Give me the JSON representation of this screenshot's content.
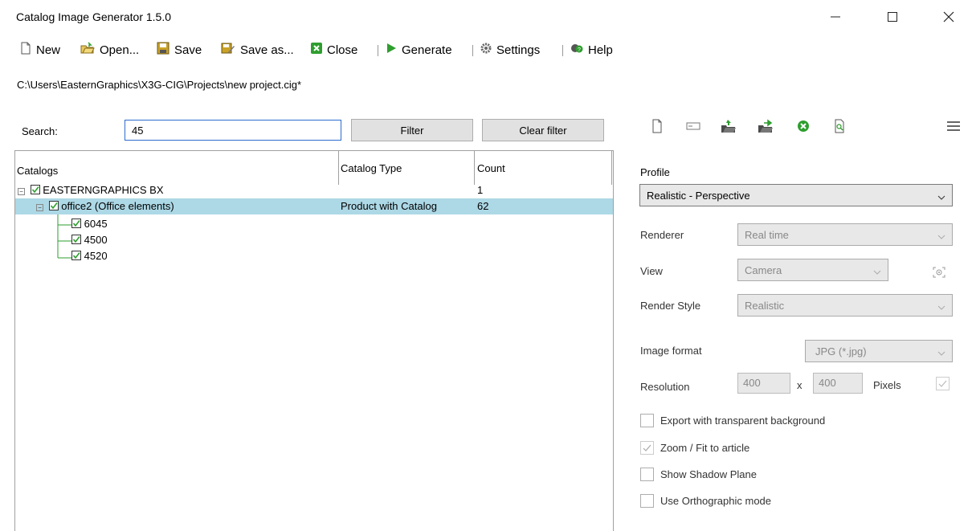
{
  "window": {
    "title": "Catalog Image Generator 1.5.0",
    "minimize_icon": "minimize-icon",
    "maximize_icon": "maximize-icon",
    "close_icon": "close-icon"
  },
  "toolbar": {
    "new_label": "New",
    "open_label": "Open...",
    "save_label": "Save",
    "saveas_label": "Save as...",
    "close_label": "Close",
    "generate_label": "Generate",
    "settings_label": "Settings",
    "help_label": "Help"
  },
  "project_path": "C:\\Users\\EasternGraphics\\X3G-CIG\\Projects\\new project.cig*",
  "search": {
    "label": "Search:",
    "value": "45",
    "filter_label": "Filter",
    "clear_filter_label": "Clear filter"
  },
  "grid": {
    "columns": [
      "Catalogs",
      "Catalog Type",
      "Count"
    ],
    "rows": [
      {
        "name": "EASTERNGRAPHICS BX",
        "type": "",
        "count": "1"
      },
      {
        "name": "office2 (Office elements)",
        "type": "Product with Catalog",
        "count": "62"
      },
      {
        "name": "6045",
        "type": "",
        "count": ""
      },
      {
        "name": "4500",
        "type": "",
        "count": ""
      },
      {
        "name": "4520",
        "type": "",
        "count": ""
      }
    ]
  },
  "profile_panel": {
    "profile_label": "Profile",
    "profile_value": "Realistic - Perspective",
    "renderer_label": "Renderer",
    "renderer_value": "Real time",
    "view_label": "View",
    "view_value": "Camera",
    "render_style_label": "Render Style",
    "render_style_value": "Realistic",
    "image_format_label": "Image format",
    "image_format_value": "JPG (*.jpg)",
    "resolution_label": "Resolution",
    "resolution_width": "400",
    "resolution_x": "x",
    "resolution_height": "400",
    "pixels_label": "Pixels",
    "options": [
      {
        "label": "Export with transparent background",
        "checked": false
      },
      {
        "label": "Zoom / Fit to article",
        "checked": true
      },
      {
        "label": "Show Shadow Plane",
        "checked": false
      },
      {
        "label": "Use Orthographic mode",
        "checked": false
      }
    ]
  },
  "colors": {
    "selected_row": "#add8e6",
    "generate_green": "#2e9e2e",
    "close_green": "#2e9e2e"
  }
}
